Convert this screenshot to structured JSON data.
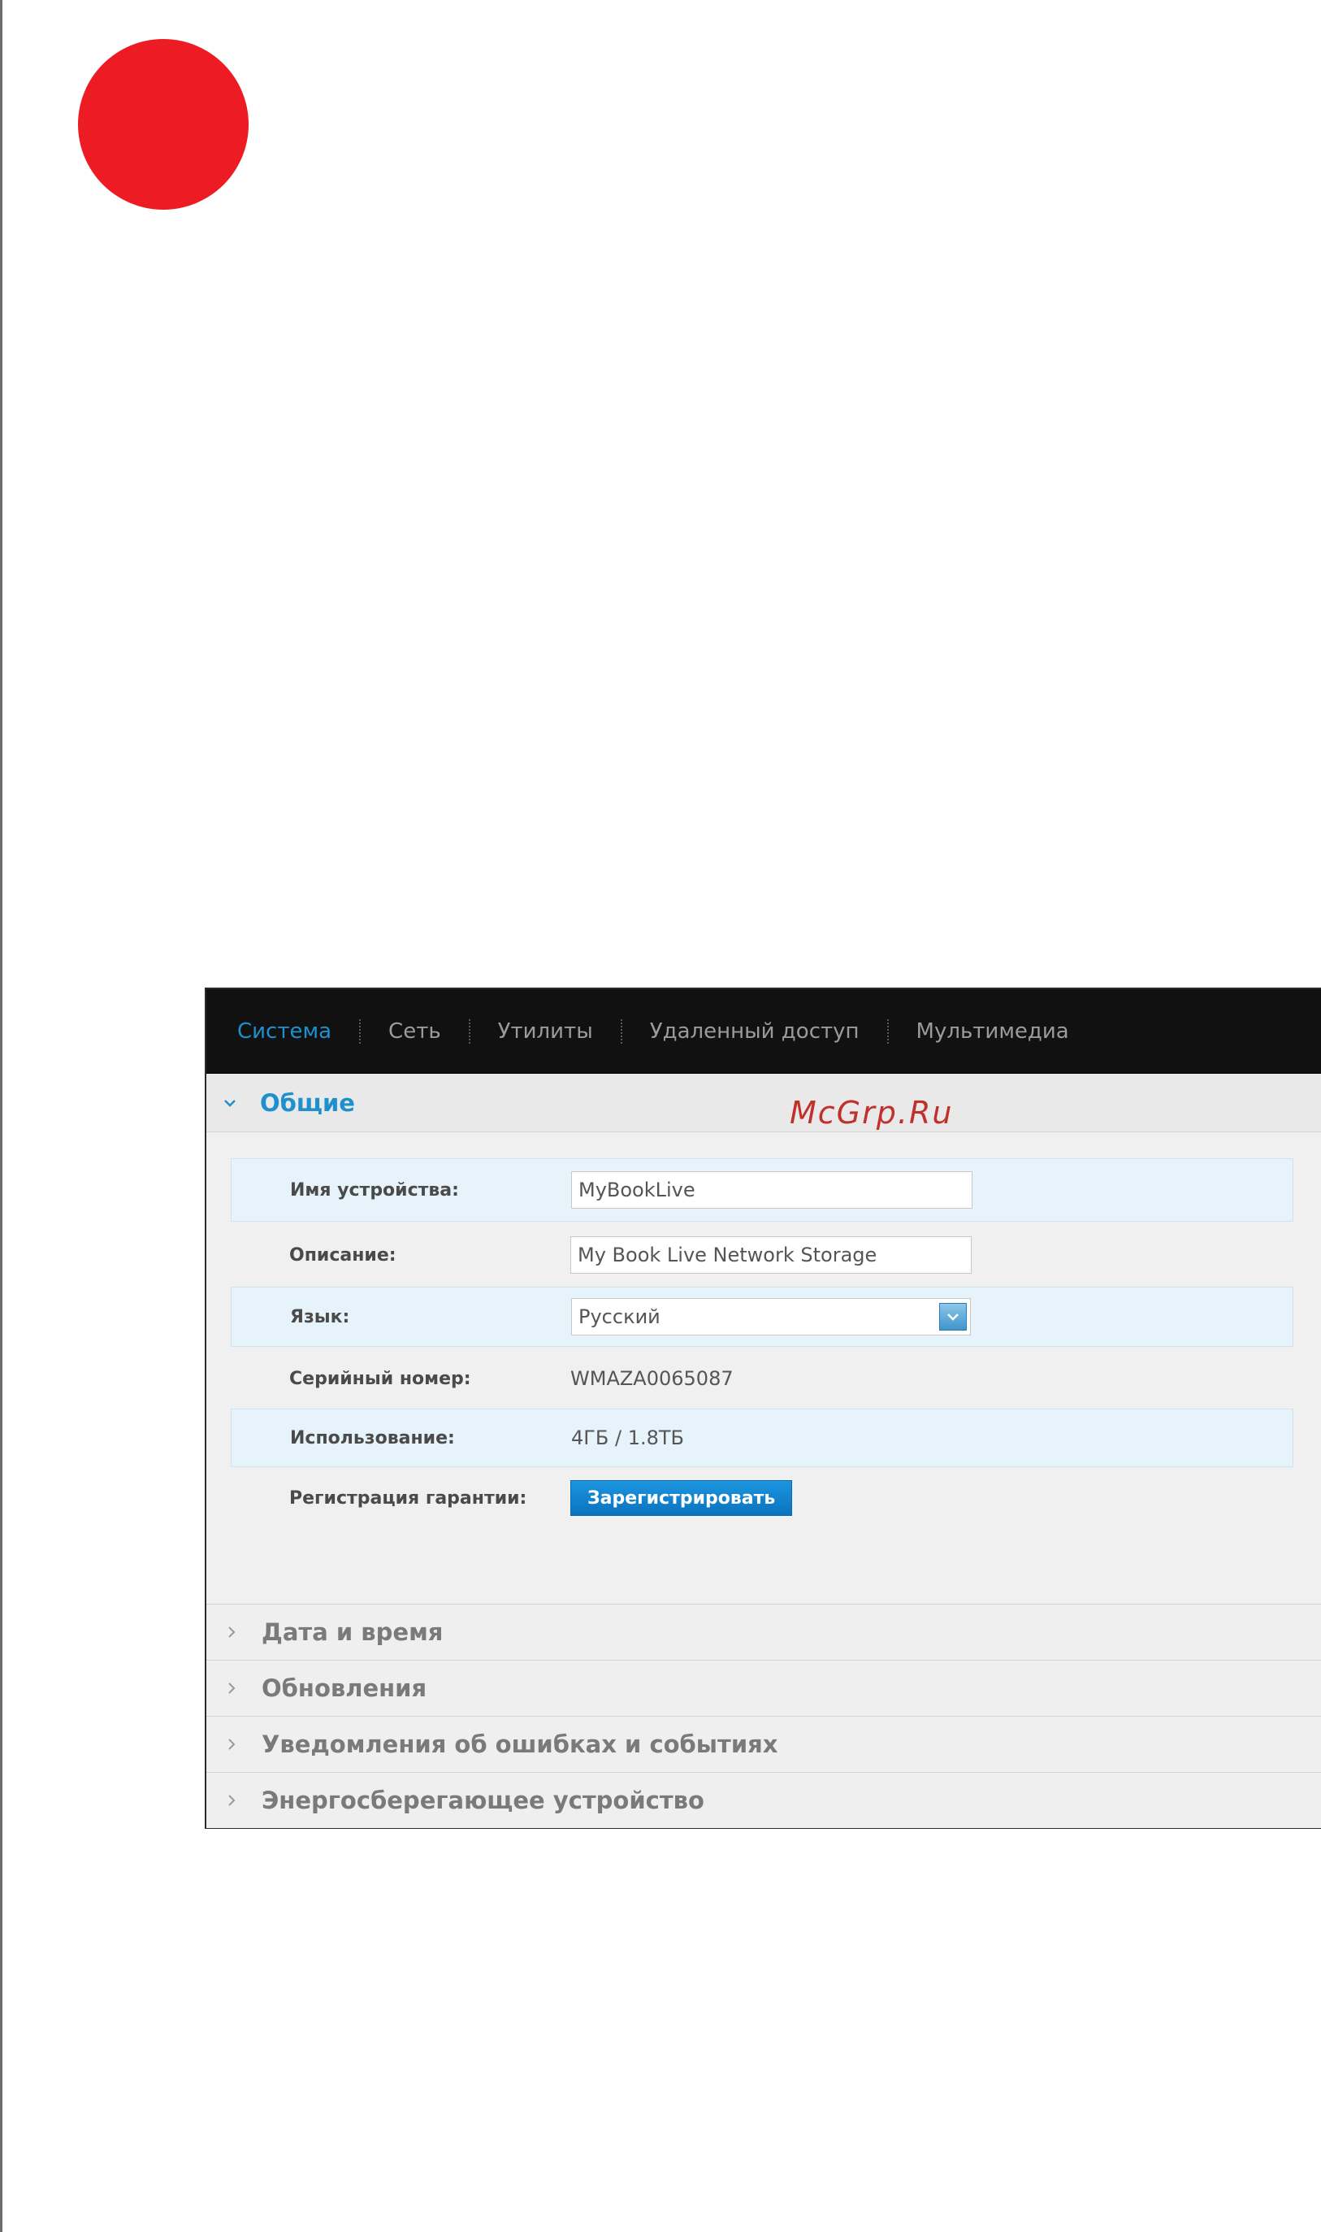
{
  "colors": {
    "accent": "#1e90ce",
    "red_dot": "#ed1c24",
    "nav_bg": "#111111",
    "row_shade": "#e6f3fa",
    "button": "#0f84d3"
  },
  "nav": {
    "items": [
      {
        "label": "Система",
        "active": true
      },
      {
        "label": "Сеть",
        "active": false
      },
      {
        "label": "Утилиты",
        "active": false
      },
      {
        "label": "Удаленный доступ",
        "active": false
      },
      {
        "label": "Мультимедиа",
        "active": false
      }
    ]
  },
  "watermark": "McGrp.Ru",
  "general": {
    "title": "Общие",
    "device_name": {
      "label": "Имя устройства:",
      "value": "MyBookLive"
    },
    "description": {
      "label": "Описание:",
      "value": "My Book Live Network Storage"
    },
    "language": {
      "label": "Язык:",
      "value": "Русский"
    },
    "serial": {
      "label": "Серийный номер:",
      "value": "WMAZA0065087"
    },
    "usage": {
      "label": "Использование:",
      "value": "4ГБ / 1.8ТБ"
    },
    "warranty": {
      "label": "Регистрация гарантии:",
      "button": "Зарегистрировать"
    }
  },
  "sections": [
    {
      "title": "Дата и время"
    },
    {
      "title": "Обновления"
    },
    {
      "title": "Уведомления об ошибках и событиях"
    },
    {
      "title": "Энергосберегающее устройство"
    }
  ],
  "icons": {
    "expanded": "chevron-down-icon",
    "collapsed": "chevron-right-icon",
    "select_arrow": "chevron-down-icon"
  }
}
